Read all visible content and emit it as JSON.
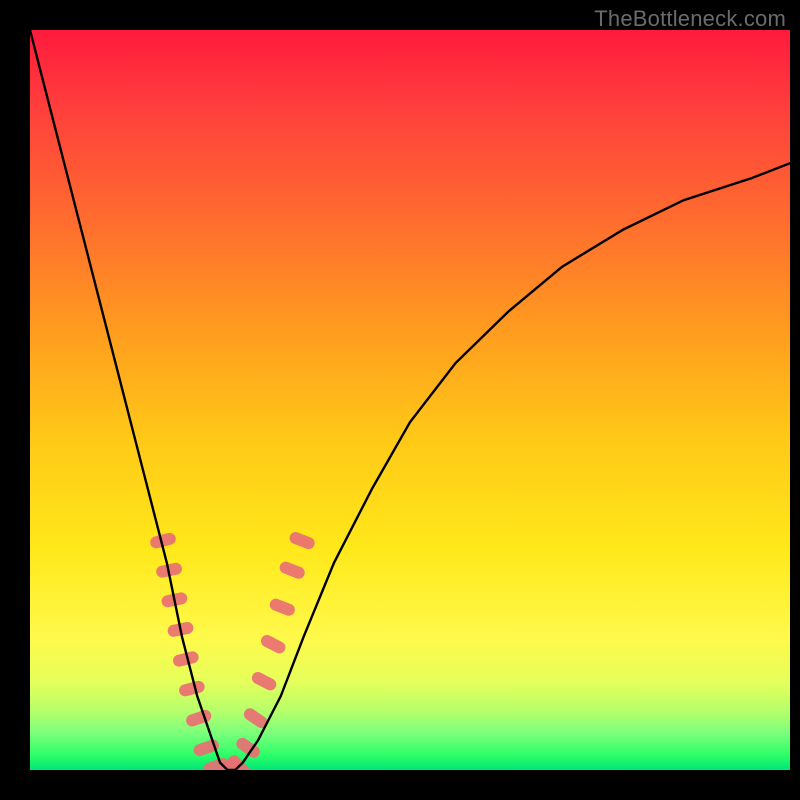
{
  "watermark": "TheBottleneck.com",
  "chart_data": {
    "type": "line",
    "title": "",
    "xlabel": "",
    "ylabel": "",
    "xlim": [
      0,
      100
    ],
    "ylim": [
      0,
      100
    ],
    "series": [
      {
        "name": "bottleneck-curve",
        "color": "#000000",
        "x": [
          0,
          3,
          6,
          9,
          12,
          15,
          18,
          20,
          22,
          24,
          25,
          26,
          27,
          28,
          30,
          33,
          36,
          40,
          45,
          50,
          56,
          63,
          70,
          78,
          86,
          95,
          100
        ],
        "values": [
          100,
          88,
          76,
          64,
          52,
          40,
          28,
          18,
          10,
          4,
          1,
          0,
          0,
          1,
          4,
          10,
          18,
          28,
          38,
          47,
          55,
          62,
          68,
          73,
          77,
          80,
          82
        ]
      }
    ],
    "markers": [
      {
        "name": "left-cluster",
        "color": "#e96f73",
        "shape": "rounded-bar",
        "points": [
          {
            "x": 17.5,
            "y": 31
          },
          {
            "x": 18.3,
            "y": 27
          },
          {
            "x": 19.0,
            "y": 23
          },
          {
            "x": 19.8,
            "y": 19
          },
          {
            "x": 20.5,
            "y": 15
          },
          {
            "x": 21.3,
            "y": 11
          },
          {
            "x": 22.2,
            "y": 7
          },
          {
            "x": 23.2,
            "y": 3
          }
        ]
      },
      {
        "name": "valley-cluster",
        "color": "#e96f73",
        "shape": "rounded-bar",
        "points": [
          {
            "x": 24.5,
            "y": 0.5
          },
          {
            "x": 26.0,
            "y": 0.2
          },
          {
            "x": 27.5,
            "y": 0.5
          }
        ]
      },
      {
        "name": "right-cluster",
        "color": "#e96f73",
        "shape": "rounded-bar",
        "points": [
          {
            "x": 28.7,
            "y": 3
          },
          {
            "x": 29.7,
            "y": 7
          },
          {
            "x": 30.8,
            "y": 12
          },
          {
            "x": 32.0,
            "y": 17
          },
          {
            "x": 33.2,
            "y": 22
          },
          {
            "x": 34.5,
            "y": 27
          },
          {
            "x": 35.8,
            "y": 31
          }
        ]
      }
    ]
  }
}
